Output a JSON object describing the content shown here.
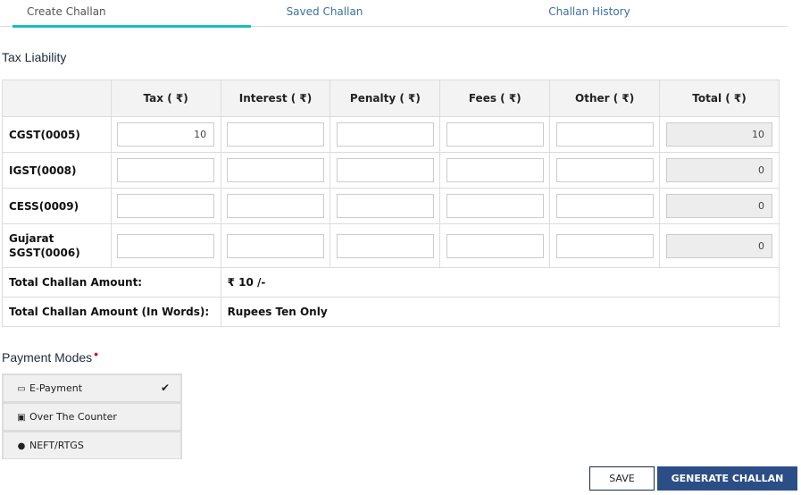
{
  "tabs": [
    {
      "label": "Create Challan",
      "active": true
    },
    {
      "label": "Saved Challan",
      "active": false
    },
    {
      "label": "Challan History",
      "active": false
    }
  ],
  "section_title": "Tax Liability",
  "table": {
    "headers": [
      "",
      "Tax ( ₹)",
      "Interest ( ₹)",
      "Penalty ( ₹)",
      "Fees ( ₹)",
      "Other ( ₹)",
      "Total ( ₹)"
    ],
    "rows": [
      {
        "label": "CGST(0005)",
        "tax": "10",
        "interest": "",
        "penalty": "",
        "fees": "",
        "other": "",
        "total": "10"
      },
      {
        "label": "IGST(0008)",
        "tax": "",
        "interest": "",
        "penalty": "",
        "fees": "",
        "other": "",
        "total": "0"
      },
      {
        "label": "CESS(0009)",
        "tax": "",
        "interest": "",
        "penalty": "",
        "fees": "",
        "other": "",
        "total": "0"
      },
      {
        "label_line1": "Gujarat",
        "label_line2": "SGST(0006)",
        "tax": "",
        "interest": "",
        "penalty": "",
        "fees": "",
        "other": "",
        "total": "0"
      }
    ],
    "total_amount_label": "Total Challan Amount:",
    "total_amount_value": "₹ 10 /-",
    "total_words_label": "Total Challan Amount (In Words):",
    "total_words_value": "Rupees Ten Only"
  },
  "payment": {
    "title": "Payment Modes",
    "required_mark": "•",
    "modes": [
      {
        "label": "E-Payment",
        "icon": "credit-card-icon",
        "glyph": "▭",
        "selected": true
      },
      {
        "label": "Over The Counter",
        "icon": "money-icon",
        "glyph": "▣",
        "selected": false
      },
      {
        "label": "NEFT/RTGS",
        "icon": "globe-icon",
        "glyph": "●",
        "selected": false
      }
    ],
    "check_glyph": "✔"
  },
  "buttons": {
    "save": "SAVE",
    "generate": "GENERATE CHALLAN"
  }
}
